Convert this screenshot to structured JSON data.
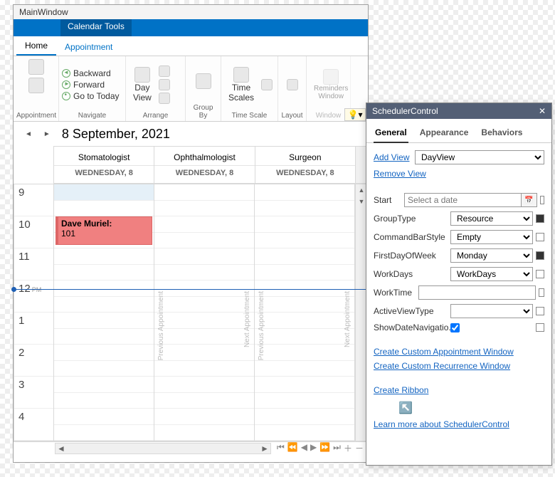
{
  "title": "MainWindow",
  "ctxTab": "Calendar Tools",
  "tabs": {
    "home": "Home",
    "appt": "Appointment"
  },
  "ribbon": {
    "navigate": {
      "back": "Backward",
      "fwd": "Forward",
      "today": "Go to Today",
      "label": "Navigate"
    },
    "appointment_label": "Appointment",
    "dayview": "Day\nView",
    "arrange": "Arrange",
    "groupby": "Group By",
    "timescales": "Time\nScales",
    "timescale_label": "Time Scale",
    "layout": "Layout",
    "reminders": "Reminders\nWindow",
    "window": "Window"
  },
  "date": "8 September, 2021",
  "resources": [
    {
      "name": "Stomatologist",
      "day": "WEDNESDAY, 8"
    },
    {
      "name": "Ophthalmologist",
      "day": "WEDNESDAY, 8"
    },
    {
      "name": "Surgeon",
      "day": "WEDNESDAY, 8"
    }
  ],
  "hours": [
    "9",
    "10",
    "11",
    "12",
    "1",
    "2",
    "3",
    "4"
  ],
  "pm": "PM",
  "appt": {
    "subj": "Dave Muriel:",
    "loc": "101"
  },
  "prev": "Previous Appointment",
  "next": "Next Appointment",
  "panel": {
    "title": "SchedulerControl",
    "tabs": {
      "g": "General",
      "a": "Appearance",
      "b": "Behaviors"
    },
    "addview": "Add View",
    "removeview": "Remove View",
    "dayview": "DayView",
    "props": {
      "start": "Start",
      "start_ph": "Select a date",
      "groupType": "GroupType",
      "groupType_v": "Resource",
      "cbs": "CommandBarStyle",
      "cbs_v": "Empty",
      "fdow": "FirstDayOfWeek",
      "fdow_v": "Monday",
      "wd": "WorkDays",
      "wd_v": "WorkDays",
      "wt": "WorkTime",
      "avt": "ActiveViewType",
      "sdn": "ShowDateNavigatio..."
    },
    "links": {
      "ccaw": "Create Custom Appointment Window",
      "ccrw": "Create Custom Recurrence Window",
      "crib": "Create Ribbon",
      "learn": "Learn more about SchedulerControl"
    }
  }
}
